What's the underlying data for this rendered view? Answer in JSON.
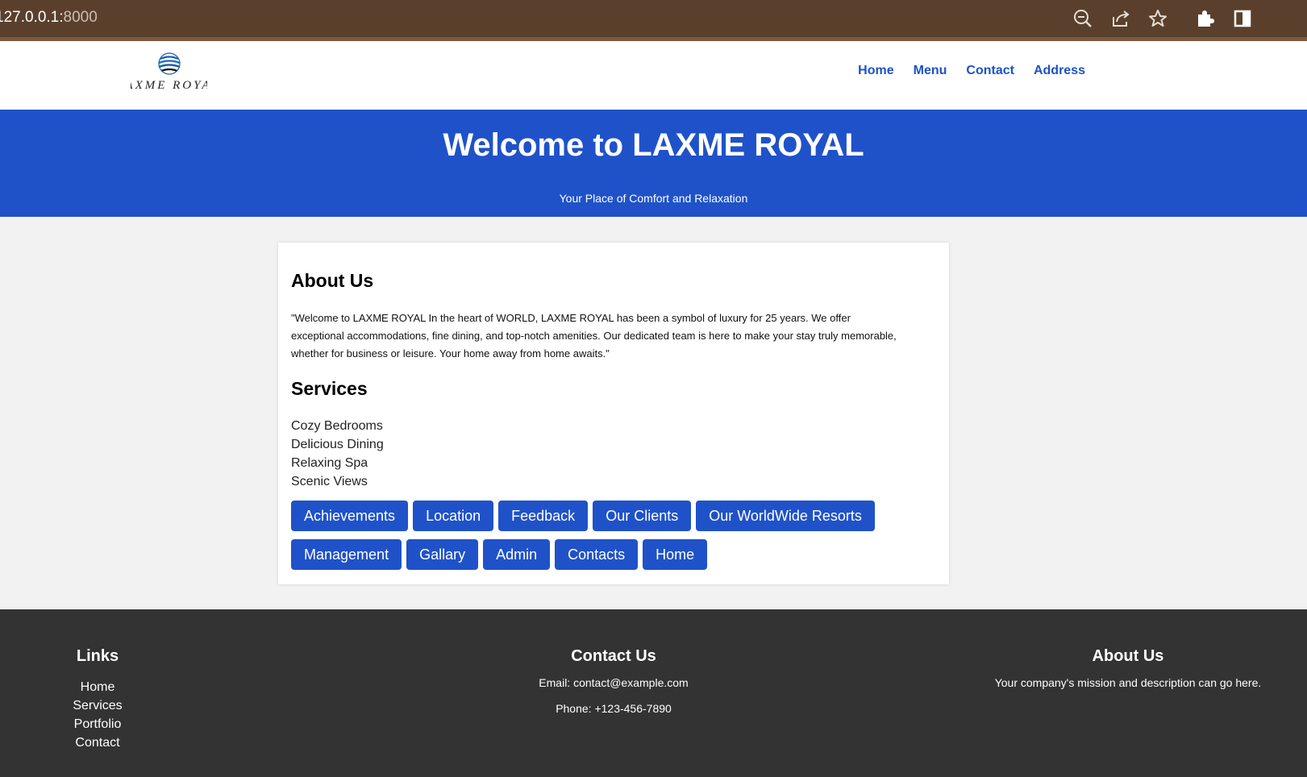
{
  "browser": {
    "url_host": "127.0.0.1:",
    "url_port": "8000",
    "icons": [
      "zoom-icon",
      "share-icon",
      "star-icon",
      "extensions-icon",
      "sidepanel-icon"
    ]
  },
  "header": {
    "logo_text": "LAXME ROYAL",
    "nav": [
      "Home",
      "Menu",
      "Contact",
      "Address"
    ]
  },
  "hero": {
    "title": "Welcome to LAXME ROYAL",
    "subtitle": "Your Place of Comfort and Relaxation"
  },
  "about": {
    "heading": "About Us",
    "text": "\"Welcome to LAXME ROYAL In the heart of WORLD, LAXME ROYAL has been a symbol of luxury for 25 years. We offer exceptional accommodations, fine dining, and top-notch amenities. Our dedicated team is here to make your stay truly memorable, whether for business or leisure. Your home away from home awaits.\""
  },
  "services": {
    "heading": "Services",
    "items": [
      "Cozy Bedrooms",
      "Delicious Dining",
      "Relaxing Spa",
      "Scenic Views"
    ]
  },
  "buttons": {
    "row1": [
      "Achievements",
      "Location",
      "Feedback",
      "Our Clients",
      "Our WorldWide Resorts"
    ],
    "row2": [
      "Management",
      "Gallary",
      "Admin",
      "Contacts",
      "Home"
    ]
  },
  "footer": {
    "links_heading": "Links",
    "links": [
      "Home",
      "Services",
      "Portfolio",
      "Contact"
    ],
    "contact_heading": "Contact Us",
    "email": "Email: contact@example.com",
    "phone": "Phone: +123-456-7890",
    "about_heading": "About Us",
    "about_text": "Your company's mission and description can go here."
  },
  "colors": {
    "brand_blue": "#1f52c9",
    "browser_brown": "#5a402c",
    "footer_bg": "#333333"
  }
}
